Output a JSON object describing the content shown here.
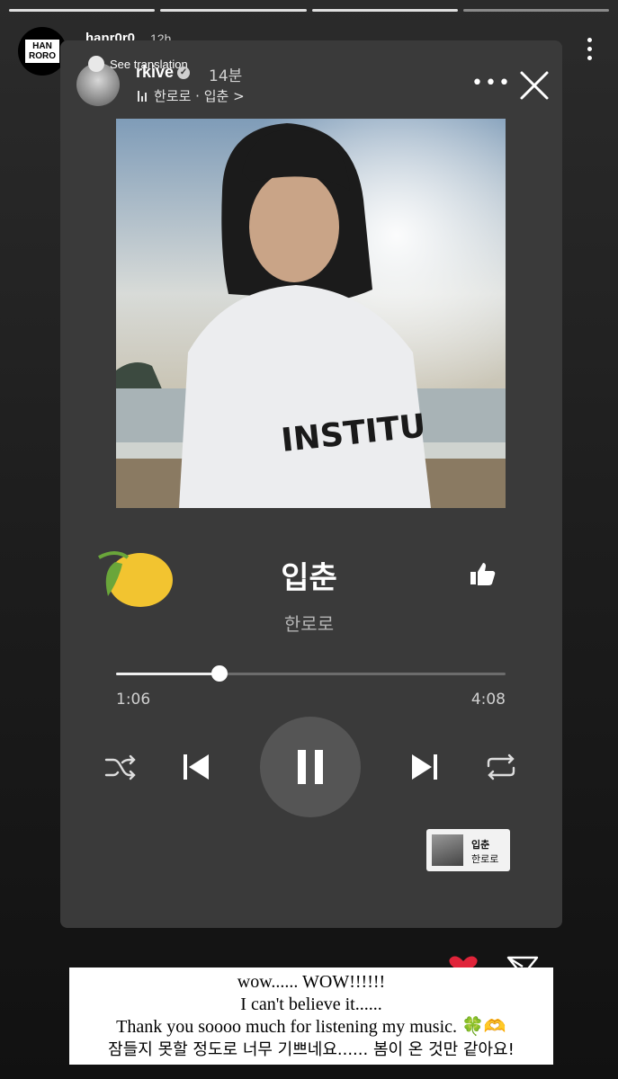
{
  "story": {
    "username": "hanr0r0",
    "time": "12h",
    "logo_text": "HAN RORO",
    "progress_segments": 5,
    "active_segment": 3
  },
  "shared_post": {
    "see_translation": "See translation",
    "username": "rkive",
    "time": "14분",
    "music_label": "한로로 · 입춘 >",
    "more_icon": "more-horizontal-icon",
    "close_icon": "close-icon"
  },
  "player": {
    "title": "입춘",
    "artist": "한로로",
    "current_time": "1:06",
    "total_time": "4:08",
    "progress_fraction": 0.266,
    "cover_text": "INSTITU"
  },
  "mini_card": {
    "title": "입춘",
    "artist": "한로로"
  },
  "caption": {
    "line1": "wow...... WOW!!!!!!",
    "line2": "I can't believe it......",
    "line3": "Thank you soooo much for listening my music. 🍀🫶",
    "line4": "잠들지 못할 정도로 너무 기쁘네요...... 봄이 온 것만 같아요!"
  },
  "colors": {
    "card": "#3a3a3a",
    "lemon": "#f2c430",
    "heart": "#e0243a"
  }
}
